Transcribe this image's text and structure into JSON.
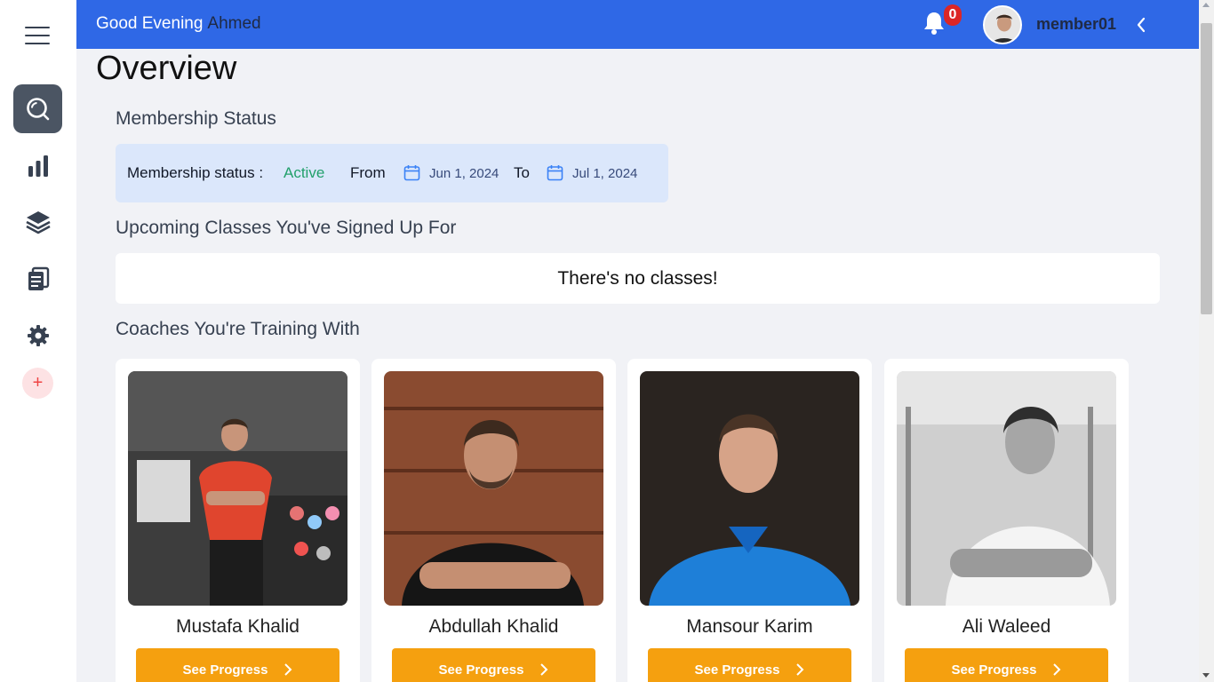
{
  "header": {
    "greeting": "Good Evening",
    "first_name": "Ahmed",
    "notification_count": "0",
    "username": "member01",
    "icons": {
      "notifications": "bell-icon",
      "collapse": "chevron-left-icon"
    }
  },
  "sidebar": {
    "items": [
      {
        "icon": "menu-icon"
      },
      {
        "icon": "search-icon",
        "active": true
      },
      {
        "icon": "bar-chart-icon"
      },
      {
        "icon": "layers-icon"
      },
      {
        "icon": "clipboard-icon"
      },
      {
        "icon": "gear-icon"
      },
      {
        "icon": "plus-icon",
        "label": "+"
      }
    ]
  },
  "main": {
    "title": "Overview",
    "membership": {
      "heading": "Membership Status",
      "status_label": "Membership status :",
      "status_value": "Active",
      "from_label": "From",
      "from_date": "Jun 1, 2024",
      "to_label": "To",
      "to_date": "Jul 1, 2024"
    },
    "classes": {
      "heading": "Upcoming Classes You've Signed Up For",
      "empty_message": "There's no classes!"
    },
    "coaches": {
      "heading": "Coaches You're Training With",
      "button_label": "See Progress",
      "items": [
        {
          "name": "Mustafa Khalid"
        },
        {
          "name": "Abdullah Khalid"
        },
        {
          "name": "Mansour Karim"
        },
        {
          "name": "Ali Waleed"
        }
      ]
    }
  },
  "colors": {
    "header_bg": "#2f68e6",
    "active_status": "#22a06b",
    "button_bg": "#f5a00f",
    "badge_bg": "#dc2626"
  }
}
